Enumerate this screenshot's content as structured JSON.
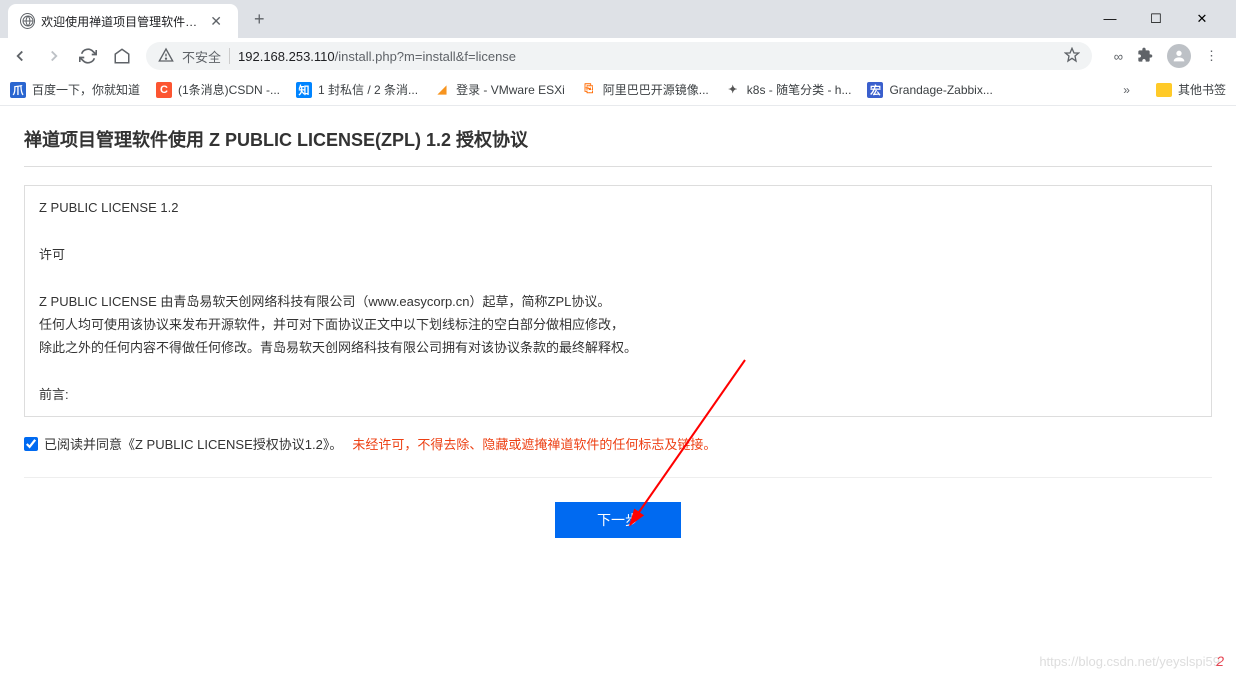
{
  "browser": {
    "tab": {
      "title": "欢迎使用禅道项目管理软件! - 禅"
    },
    "addressBar": {
      "notSecure": "不安全",
      "urlHost": "192.168.253.110",
      "urlPath": "/install.php?m=install&f=license"
    },
    "bookmarks": [
      {
        "label": "百度一下，你就知道",
        "icon": "爪",
        "iconBg": "#2a66d0",
        "iconColor": "#fff"
      },
      {
        "label": "(1条消息)CSDN -...",
        "icon": "C",
        "iconBg": "#fc5531",
        "iconColor": "#fff"
      },
      {
        "label": "1 封私信 / 2 条消...",
        "icon": "知",
        "iconBg": "#0084ff",
        "iconColor": "#fff"
      },
      {
        "label": "登录 - VMware ESXi",
        "icon": "◢",
        "iconBg": "transparent",
        "iconColor": "#f7941e"
      },
      {
        "label": "阿里巴巴开源镜像...",
        "icon": "⎘",
        "iconBg": "transparent",
        "iconColor": "#ff6a00"
      },
      {
        "label": "k8s - 随笔分类 - h...",
        "icon": "✦",
        "iconBg": "transparent",
        "iconColor": "#555"
      },
      {
        "label": "Grandage-Zabbix...",
        "icon": "宏",
        "iconBg": "#3a5fcd",
        "iconColor": "#fff"
      }
    ],
    "otherBookmarks": "其他书签"
  },
  "page": {
    "title": "禅道项目管理软件使用 Z PUBLIC LICENSE(ZPL) 1.2 授权协议",
    "licenseText": "Z PUBLIC LICENSE 1.2\n\n许可\n\nZ PUBLIC LICENSE 由青岛易软天创网络科技有限公司（www.easycorp.cn）起草，简称ZPL协议。\n任何人均可使用该协议来发布开源软件，并可对下面协议正文中以下划线标注的空白部分做相应修改，\n除此之外的任何内容不得做任何修改。青岛易软天创网络科技有限公司拥有对该协议条款的最终解释权。\n\n前言:\n\n禅道项目管理软件（以下简称该软件） 由 青岛易软天创网络科技有限公司（www.easycorp.cn）开发（以下简称我）。我依法拥有该软件的所有版权。\n本着共享开放的角度，我以开放源代码的形式发布该软件。您可以在遵守该协议的前提下使用该软件。",
    "agreePrefix": " 已阅读并同意《Z PUBLIC LICENSE授权协议1.2》。",
    "agreeWarn": "未经许可，不得去除、隐藏或遮掩禅道软件的任何标志及链接。",
    "nextButton": "下一步"
  },
  "annotation": {
    "pageNumber": "2",
    "watermark": "https://blog.csdn.net/yeyslspi59"
  }
}
